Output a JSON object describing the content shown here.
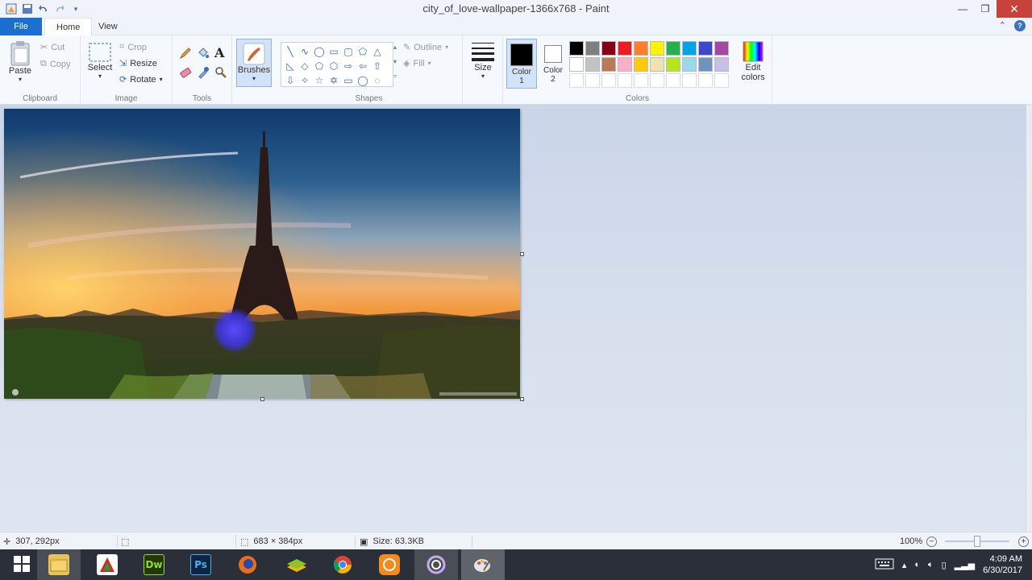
{
  "window": {
    "title": "city_of_love-wallpaper-1366x768 - Paint",
    "controls": {
      "minimize": "—",
      "restore": "❐",
      "close": "✕"
    }
  },
  "tabs": {
    "file": "File",
    "home": "Home",
    "view": "View"
  },
  "ribbon": {
    "clipboard": {
      "label": "Clipboard",
      "paste": "Paste",
      "cut": "Cut",
      "copy": "Copy"
    },
    "image": {
      "label": "Image",
      "select": "Select",
      "crop": "Crop",
      "resize": "Resize",
      "rotate": "Rotate"
    },
    "tools": {
      "label": "Tools"
    },
    "brushes": {
      "label": "Brushes"
    },
    "shapes": {
      "label": "Shapes",
      "outline": "Outline",
      "fill": "Fill"
    },
    "size": {
      "label": "Size"
    },
    "colors": {
      "label": "Colors",
      "color1": "Color 1",
      "color1_value": "#000000",
      "color2": "Color 2",
      "color2_value": "#ffffff",
      "edit": "Edit colors",
      "palette_row1": [
        "#000000",
        "#7f7f7f",
        "#880015",
        "#ed1c24",
        "#ff7f27",
        "#fff200",
        "#22b14c",
        "#00a2e8",
        "#3f48cc",
        "#a349a4"
      ],
      "palette_row2": [
        "#ffffff",
        "#c3c3c3",
        "#b97a57",
        "#ffaec9",
        "#ffc90e",
        "#efe4b0",
        "#b5e61d",
        "#99d9ea",
        "#7092be",
        "#c8bfe7"
      ],
      "palette_row3": [
        "#ffffff",
        "#ffffff",
        "#ffffff",
        "#ffffff",
        "#ffffff",
        "#ffffff",
        "#ffffff",
        "#ffffff",
        "#ffffff",
        "#ffffff"
      ]
    }
  },
  "status": {
    "cursor_pos": "307, 292px",
    "image_size": "683 × 384px",
    "file_size": "Size: 63.3KB",
    "zoom": "100%"
  },
  "taskbar": {
    "apps": [
      "windows-start",
      "file-explorer",
      "pdf-app",
      "dreamweaver",
      "photoshop",
      "firefox",
      "bluestacks",
      "chrome",
      "app-orange",
      "app-purple",
      "paint"
    ],
    "dw_label": "Dw",
    "ps_label": "Ps",
    "time": "4:09 AM",
    "date": "6/30/2017"
  }
}
